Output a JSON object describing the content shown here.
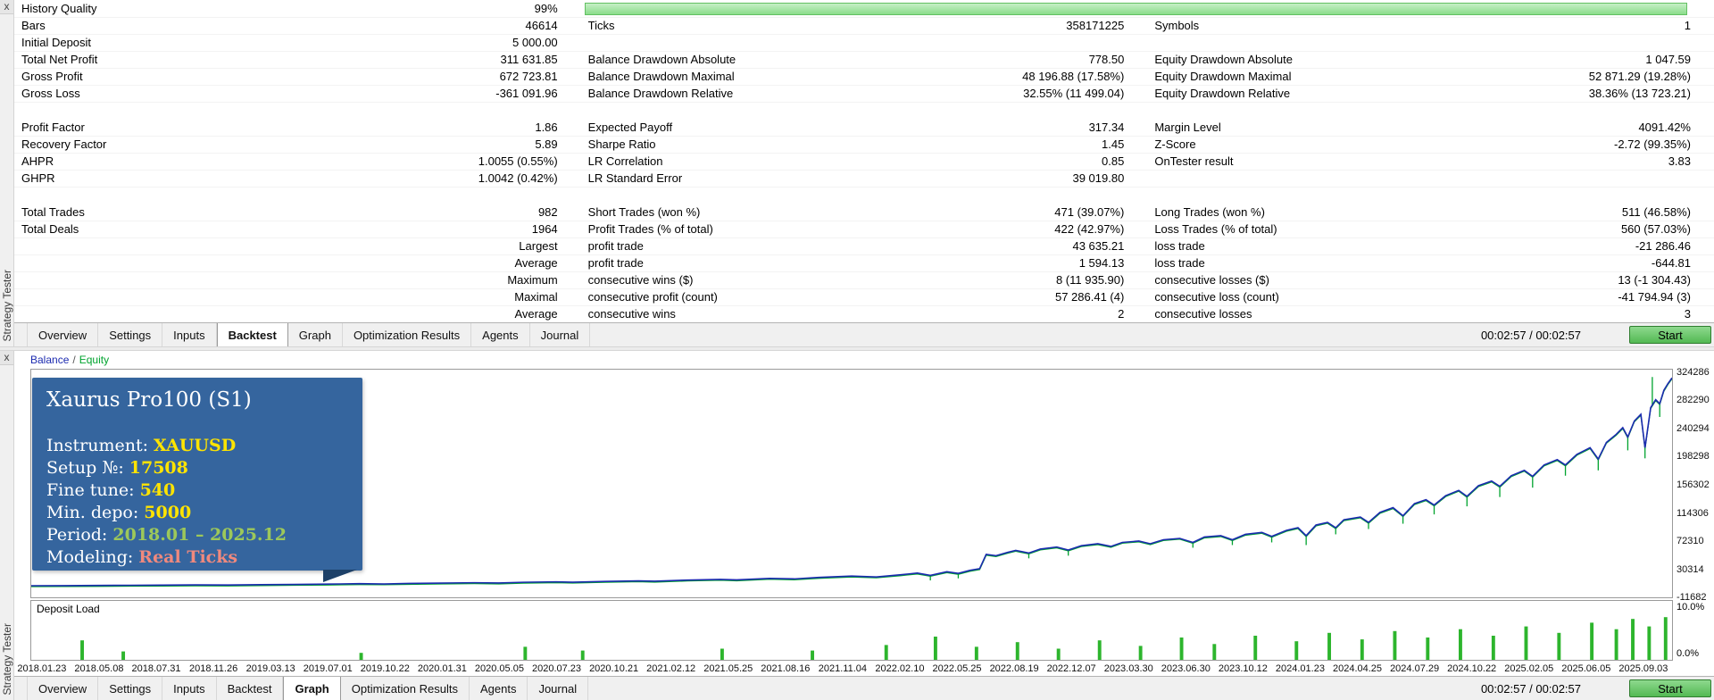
{
  "tabs": [
    "Overview",
    "Settings",
    "Inputs",
    "Backtest",
    "Graph",
    "Optimization Results",
    "Agents",
    "Journal"
  ],
  "top_panel": {
    "close_label": "x",
    "strip_label": "Strategy Tester",
    "active_tab": "Backtest",
    "time": "00:02:57 / 00:02:57",
    "start_label": "Start",
    "stats": {
      "quality_percent": "99%",
      "rows": [
        {
          "type": "quality",
          "cells": [
            "History Quality",
            "99%"
          ]
        },
        {
          "type": "data",
          "cells": [
            "Bars",
            "46614",
            "Ticks",
            "358171225",
            "Symbols",
            "1"
          ]
        },
        {
          "type": "data",
          "cells": [
            "Initial Deposit",
            "5 000.00",
            "",
            "",
            "",
            ""
          ]
        },
        {
          "type": "data",
          "cells": [
            "Total Net Profit",
            "311 631.85",
            "Balance Drawdown Absolute",
            "778.50",
            "Equity Drawdown Absolute",
            "1 047.59"
          ]
        },
        {
          "type": "data",
          "cells": [
            "Gross Profit",
            "672 723.81",
            "Balance Drawdown Maximal",
            "48 196.88 (17.58%)",
            "Equity Drawdown Maximal",
            "52 871.29 (19.28%)"
          ]
        },
        {
          "type": "data",
          "cells": [
            "Gross Loss",
            "-361 091.96",
            "Balance Drawdown Relative",
            "32.55% (11 499.04)",
            "Equity Drawdown Relative",
            "38.36% (13 723.21)"
          ]
        },
        {
          "type": "spacer"
        },
        {
          "type": "data",
          "cells": [
            "Profit Factor",
            "1.86",
            "Expected Payoff",
            "317.34",
            "Margin Level",
            "4091.42%"
          ]
        },
        {
          "type": "data",
          "cells": [
            "Recovery Factor",
            "5.89",
            "Sharpe Ratio",
            "1.45",
            "Z-Score",
            "-2.72 (99.35%)"
          ]
        },
        {
          "type": "data",
          "cells": [
            "AHPR",
            "1.0055 (0.55%)",
            "LR Correlation",
            "0.85",
            "OnTester result",
            "3.83"
          ]
        },
        {
          "type": "data",
          "cells": [
            "GHPR",
            "1.0042 (0.42%)",
            "LR Standard Error",
            "39 019.80",
            "",
            ""
          ]
        },
        {
          "type": "spacer"
        },
        {
          "type": "data",
          "cells": [
            "Total Trades",
            "982",
            "Short Trades (won %)",
            "471 (39.07%)",
            "Long Trades (won %)",
            "511 (46.58%)"
          ]
        },
        {
          "type": "data",
          "cells": [
            "Total Deals",
            "1964",
            "Profit Trades (% of total)",
            "422 (42.97%)",
            "Loss Trades (% of total)",
            "560 (57.03%)"
          ]
        },
        {
          "type": "data",
          "cells": [
            "",
            "Largest",
            "profit trade",
            "43 635.21",
            "loss trade",
            "-21 286.46"
          ]
        },
        {
          "type": "data",
          "cells": [
            "",
            "Average",
            "profit trade",
            "1 594.13",
            "loss trade",
            "-644.81"
          ]
        },
        {
          "type": "data",
          "cells": [
            "",
            "Maximum",
            "consecutive wins ($)",
            "8 (11 935.90)",
            "consecutive losses ($)",
            "13 (-1 304.43)"
          ]
        },
        {
          "type": "data",
          "cells": [
            "",
            "Maximal",
            "consecutive profit (count)",
            "57 286.41 (4)",
            "consecutive loss (count)",
            "-41 794.94 (3)"
          ]
        },
        {
          "type": "data",
          "cells": [
            "",
            "Average",
            "consecutive wins",
            "2",
            "consecutive losses",
            "3"
          ]
        }
      ]
    }
  },
  "bottom_panel": {
    "close_label": "x",
    "strip_label": "Strategy Tester",
    "active_tab": "Graph",
    "time": "00:02:57 / 00:02:57",
    "start_label": "Start",
    "legend": {
      "balance": "Balance",
      "sep": "/",
      "equity": "Equity"
    }
  },
  "info_box": {
    "title": "Xaurus Pro100 (S1)",
    "bg": "#35659e",
    "lines": [
      {
        "label": "Instrument: ",
        "value": "XAUUSD",
        "color": "#ffe400"
      },
      {
        "label": "Setup №: ",
        "value": "17508",
        "color": "#ffe400"
      },
      {
        "label": "Fine tune: ",
        "value": "540",
        "color": "#ffe400"
      },
      {
        "label": "Min. depo: ",
        "value": "5000",
        "color": "#ffe400"
      },
      {
        "label": "Period: ",
        "value": "2018.01 – 2025.12",
        "color": "#9dc85a"
      },
      {
        "label": "Modeling: ",
        "value": "Real Ticks",
        "color": "#f0897d"
      }
    ]
  },
  "chart_data": {
    "type": "line",
    "title": "Balance / Equity",
    "ylim": [
      -12400,
      329000
    ],
    "y_ticks": [
      324286,
      282290,
      240294,
      198298,
      156302,
      114306,
      72310,
      30314,
      -11682
    ],
    "x_ticks": [
      "2018.01.23",
      "2018.05.08",
      "2018.07.31",
      "2018.11.26",
      "2019.03.13",
      "2019.07.01",
      "2019.10.22",
      "2020.01.31",
      "2020.05.05",
      "2020.07.23",
      "2020.10.21",
      "2021.02.12",
      "2021.05.25",
      "2021.08.16",
      "2021.11.04",
      "2022.02.10",
      "2022.05.25",
      "2022.08.19",
      "2022.12.07",
      "2023.03.30",
      "2023.06.30",
      "2023.10.12",
      "2024.01.23",
      "2024.04.25",
      "2024.07.29",
      "2024.10.22",
      "2025.02.05",
      "2025.06.05",
      "2025.09.03"
    ],
    "series": [
      {
        "name": "Balance",
        "color": "#1c2bb0",
        "points": [
          [
            0,
            5000
          ],
          [
            0.02,
            5150
          ],
          [
            0.04,
            5350
          ],
          [
            0.06,
            5600
          ],
          [
            0.08,
            5900
          ],
          [
            0.1,
            6200
          ],
          [
            0.12,
            6050
          ],
          [
            0.14,
            6600
          ],
          [
            0.16,
            7000
          ],
          [
            0.18,
            7400
          ],
          [
            0.2,
            8000
          ],
          [
            0.215,
            7700
          ],
          [
            0.23,
            8400
          ],
          [
            0.25,
            9000
          ],
          [
            0.27,
            9500
          ],
          [
            0.285,
            9100
          ],
          [
            0.3,
            10200
          ],
          [
            0.32,
            10800
          ],
          [
            0.33,
            10300
          ],
          [
            0.35,
            11500
          ],
          [
            0.37,
            12300
          ],
          [
            0.38,
            11800
          ],
          [
            0.4,
            13500
          ],
          [
            0.42,
            14500
          ],
          [
            0.43,
            13800
          ],
          [
            0.45,
            16000
          ],
          [
            0.465,
            15200
          ],
          [
            0.48,
            17500
          ],
          [
            0.5,
            19500
          ],
          [
            0.515,
            18200
          ],
          [
            0.53,
            21500
          ],
          [
            0.54,
            24000
          ],
          [
            0.548,
            20500
          ],
          [
            0.558,
            26000
          ],
          [
            0.565,
            23500
          ],
          [
            0.572,
            28000
          ],
          [
            0.578,
            30500
          ],
          [
            0.582,
            52000
          ],
          [
            0.588,
            50000
          ],
          [
            0.595,
            55000
          ],
          [
            0.6,
            58000
          ],
          [
            0.608,
            54000
          ],
          [
            0.615,
            60000
          ],
          [
            0.625,
            63000
          ],
          [
            0.632,
            58500
          ],
          [
            0.64,
            65000
          ],
          [
            0.65,
            68000
          ],
          [
            0.658,
            64000
          ],
          [
            0.665,
            70000
          ],
          [
            0.675,
            72000
          ],
          [
            0.682,
            68000
          ],
          [
            0.69,
            74000
          ],
          [
            0.7,
            76000
          ],
          [
            0.708,
            70000
          ],
          [
            0.715,
            78000
          ],
          [
            0.725,
            80000
          ],
          [
            0.732,
            74000
          ],
          [
            0.74,
            82000
          ],
          [
            0.75,
            85000
          ],
          [
            0.756,
            79000
          ],
          [
            0.765,
            88000
          ],
          [
            0.772,
            92000
          ],
          [
            0.777,
            80000
          ],
          [
            0.783,
            96000
          ],
          [
            0.79,
            100000
          ],
          [
            0.795,
            92000
          ],
          [
            0.8,
            104000
          ],
          [
            0.81,
            108000
          ],
          [
            0.815,
            100000
          ],
          [
            0.822,
            115000
          ],
          [
            0.83,
            122000
          ],
          [
            0.836,
            110000
          ],
          [
            0.843,
            128000
          ],
          [
            0.85,
            134000
          ],
          [
            0.855,
            126000
          ],
          [
            0.862,
            140000
          ],
          [
            0.87,
            148000
          ],
          [
            0.875,
            139000
          ],
          [
            0.882,
            155000
          ],
          [
            0.89,
            162000
          ],
          [
            0.895,
            154000
          ],
          [
            0.902,
            170000
          ],
          [
            0.91,
            178000
          ],
          [
            0.915,
            169000
          ],
          [
            0.922,
            186000
          ],
          [
            0.93,
            194000
          ],
          [
            0.935,
            186000
          ],
          [
            0.942,
            202000
          ],
          [
            0.95,
            212000
          ],
          [
            0.955,
            195000
          ],
          [
            0.96,
            220000
          ],
          [
            0.966,
            232000
          ],
          [
            0.97,
            242000
          ],
          [
            0.973,
            228000
          ],
          [
            0.977,
            252000
          ],
          [
            0.981,
            262000
          ],
          [
            0.9835,
            212000
          ],
          [
            0.987,
            272000
          ],
          [
            0.99,
            284000
          ],
          [
            0.9925,
            278000
          ],
          [
            0.995,
            298000
          ],
          [
            0.9975,
            308000
          ],
          [
            1,
            316600
          ]
        ]
      },
      {
        "name": "Equity",
        "color": "#00a32e",
        "spikes": [
          [
            0.548,
            13000
          ],
          [
            0.565,
            16000
          ],
          [
            0.608,
            46000
          ],
          [
            0.632,
            50000
          ],
          [
            0.708,
            62000
          ],
          [
            0.732,
            66000
          ],
          [
            0.756,
            70000
          ],
          [
            0.777,
            66000
          ],
          [
            0.795,
            82000
          ],
          [
            0.815,
            90000
          ],
          [
            0.836,
            98000
          ],
          [
            0.855,
            112000
          ],
          [
            0.875,
            124000
          ],
          [
            0.895,
            138000
          ],
          [
            0.915,
            152000
          ],
          [
            0.935,
            170000
          ],
          [
            0.955,
            178000
          ],
          [
            0.973,
            208000
          ],
          [
            0.9835,
            196000
          ],
          [
            0.988,
            318000
          ],
          [
            0.9925,
            258000
          ]
        ]
      }
    ],
    "deposit_load": {
      "label": "Deposit Load",
      "max_label": "10.0%",
      "min_label": "0.0%",
      "bar_color": "#2db52d",
      "bars": [
        [
          0.03,
          0.42
        ],
        [
          0.055,
          0.18
        ],
        [
          0.2,
          0.15
        ],
        [
          0.3,
          0.28
        ],
        [
          0.335,
          0.2
        ],
        [
          0.42,
          0.24
        ],
        [
          0.475,
          0.2
        ],
        [
          0.52,
          0.32
        ],
        [
          0.55,
          0.5
        ],
        [
          0.575,
          0.28
        ],
        [
          0.6,
          0.38
        ],
        [
          0.625,
          0.24
        ],
        [
          0.65,
          0.42
        ],
        [
          0.675,
          0.3
        ],
        [
          0.7,
          0.48
        ],
        [
          0.72,
          0.34
        ],
        [
          0.745,
          0.52
        ],
        [
          0.77,
          0.4
        ],
        [
          0.79,
          0.58
        ],
        [
          0.81,
          0.44
        ],
        [
          0.83,
          0.62
        ],
        [
          0.85,
          0.48
        ],
        [
          0.87,
          0.66
        ],
        [
          0.89,
          0.52
        ],
        [
          0.91,
          0.72
        ],
        [
          0.93,
          0.58
        ],
        [
          0.95,
          0.8
        ],
        [
          0.965,
          0.66
        ],
        [
          0.975,
          0.88
        ],
        [
          0.985,
          0.72
        ],
        [
          0.995,
          0.92
        ]
      ]
    }
  }
}
